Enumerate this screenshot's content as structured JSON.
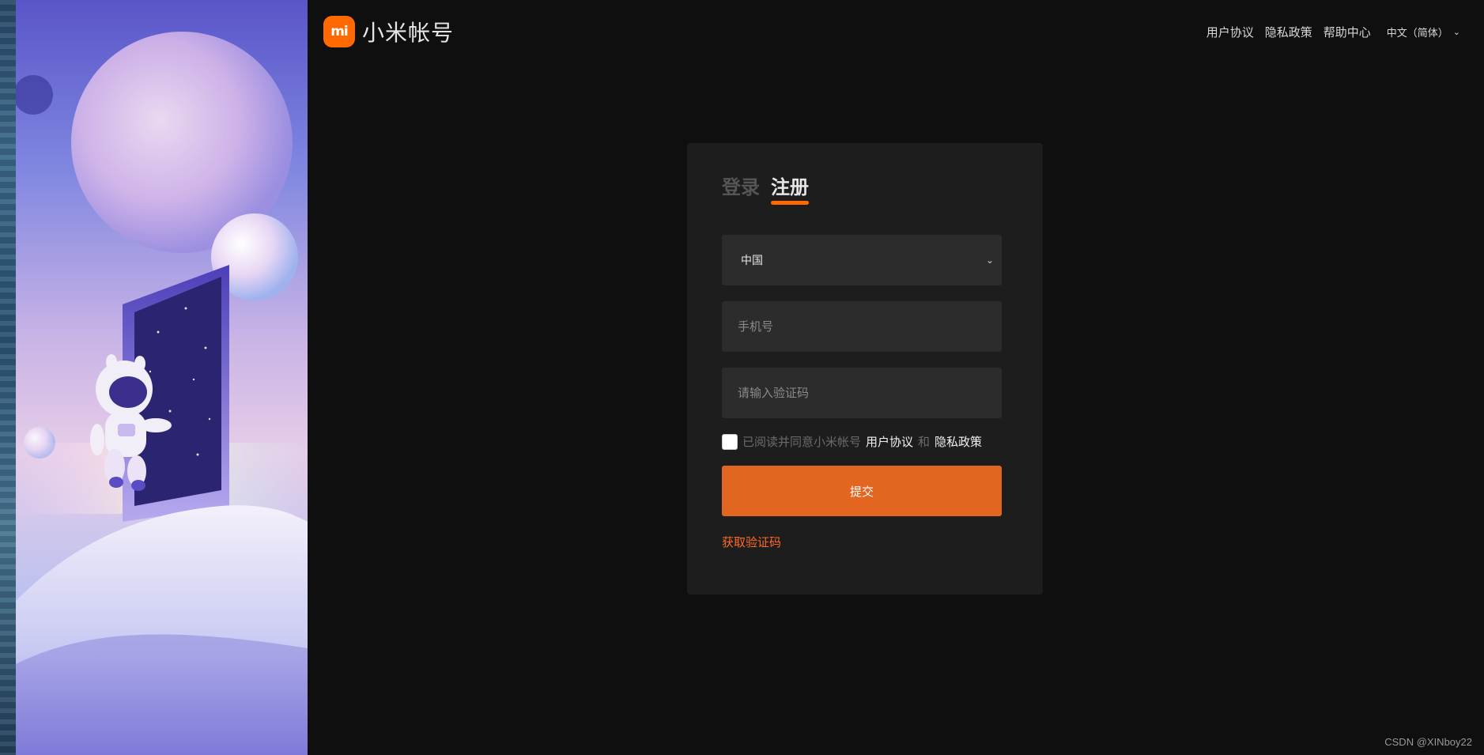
{
  "brand": {
    "logo_text": "mi",
    "name": "小米帐号",
    "accent": "#ff6900"
  },
  "header_nav": {
    "links": [
      "用户协议",
      "隐私政策",
      "帮助中心"
    ],
    "language": "中文（简体）"
  },
  "form": {
    "tabs": [
      {
        "label": "登录",
        "active": false
      },
      {
        "label": "注册",
        "active": true
      }
    ],
    "region": {
      "selected": "中国"
    },
    "phone": {
      "placeholder": "手机号",
      "value": ""
    },
    "code": {
      "placeholder": "请输入验证码",
      "value": ""
    },
    "agreement": {
      "checked": false,
      "prefix": "已阅读并同意小米帐号",
      "link1": "用户协议",
      "joiner": "和",
      "link2": "隐私政策"
    },
    "submit_label": "提交",
    "get_code_label": "获取验证码",
    "submit_color": "#e2661f"
  },
  "watermark": "CSDN @XINboy22"
}
